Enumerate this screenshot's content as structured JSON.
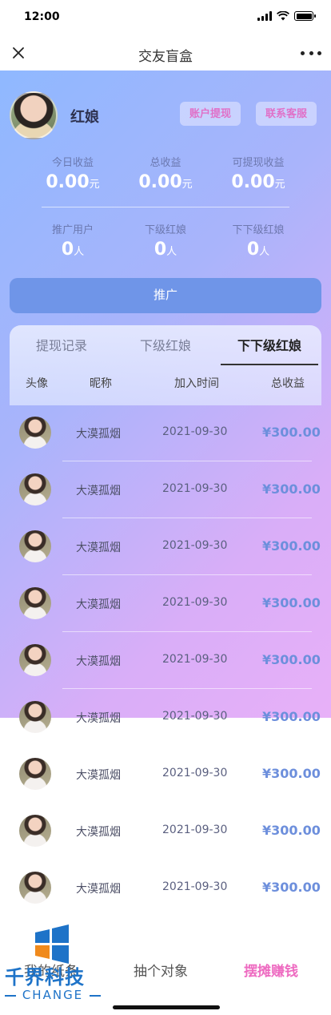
{
  "status_bar": {
    "time": "12:00"
  },
  "nav": {
    "title": "交友盲盒"
  },
  "profile": {
    "name": "红娘",
    "withdraw_btn": "账户提现",
    "service_btn": "联系客服"
  },
  "stats_income": [
    {
      "label": "今日收益",
      "value": "0.00",
      "unit": "元"
    },
    {
      "label": "总收益",
      "value": "0.00",
      "unit": "元"
    },
    {
      "label": "可提现收益",
      "value": "0.00",
      "unit": "元"
    }
  ],
  "stats_users": [
    {
      "label": "推广用户",
      "value": "0",
      "unit": "人"
    },
    {
      "label": "下级红娘",
      "value": "0",
      "unit": "人"
    },
    {
      "label": "下下级红娘",
      "value": "0",
      "unit": "人"
    }
  ],
  "promote_btn": "推广",
  "tabs": [
    {
      "label": "提现记录",
      "active": false
    },
    {
      "label": "下级红娘",
      "active": false
    },
    {
      "label": "下下级红娘",
      "active": true
    }
  ],
  "columns": {
    "avatar": "头像",
    "nickname": "昵称",
    "join_time": "加入时间",
    "total": "总收益"
  },
  "rows": [
    {
      "nickname": "大漠孤烟",
      "time": "2021-09-30",
      "amount": "¥300.00"
    },
    {
      "nickname": "大漠孤烟",
      "time": "2021-09-30",
      "amount": "¥300.00"
    },
    {
      "nickname": "大漠孤烟",
      "time": "2021-09-30",
      "amount": "¥300.00"
    },
    {
      "nickname": "大漠孤烟",
      "time": "2021-09-30",
      "amount": "¥300.00"
    },
    {
      "nickname": "大漠孤烟",
      "time": "2021-09-30",
      "amount": "¥300.00"
    },
    {
      "nickname": "大漠孤烟",
      "time": "2021-09-30",
      "amount": "¥300.00"
    },
    {
      "nickname": "大漠孤烟",
      "time": "2021-09-30",
      "amount": "¥300.00"
    },
    {
      "nickname": "大漠孤烟",
      "time": "2021-09-30",
      "amount": "¥300.00"
    },
    {
      "nickname": "大漠孤烟",
      "time": "2021-09-30",
      "amount": "¥300.00"
    }
  ],
  "bottom_tabs": [
    {
      "label": "我的纸条"
    },
    {
      "label": "抽个对象"
    },
    {
      "label": "摆摊赚钱",
      "active": true
    }
  ],
  "watermark": {
    "text": "千界科技",
    "sub": "CHANGE"
  },
  "colors": {
    "accent_pink": "#ee6bc1",
    "amount_blue": "#6d8fdc",
    "promote_blue": "#6f95e8"
  },
  "icons": [
    "close-icon",
    "more-icon",
    "signal-icon",
    "wifi-icon",
    "battery-icon"
  ]
}
